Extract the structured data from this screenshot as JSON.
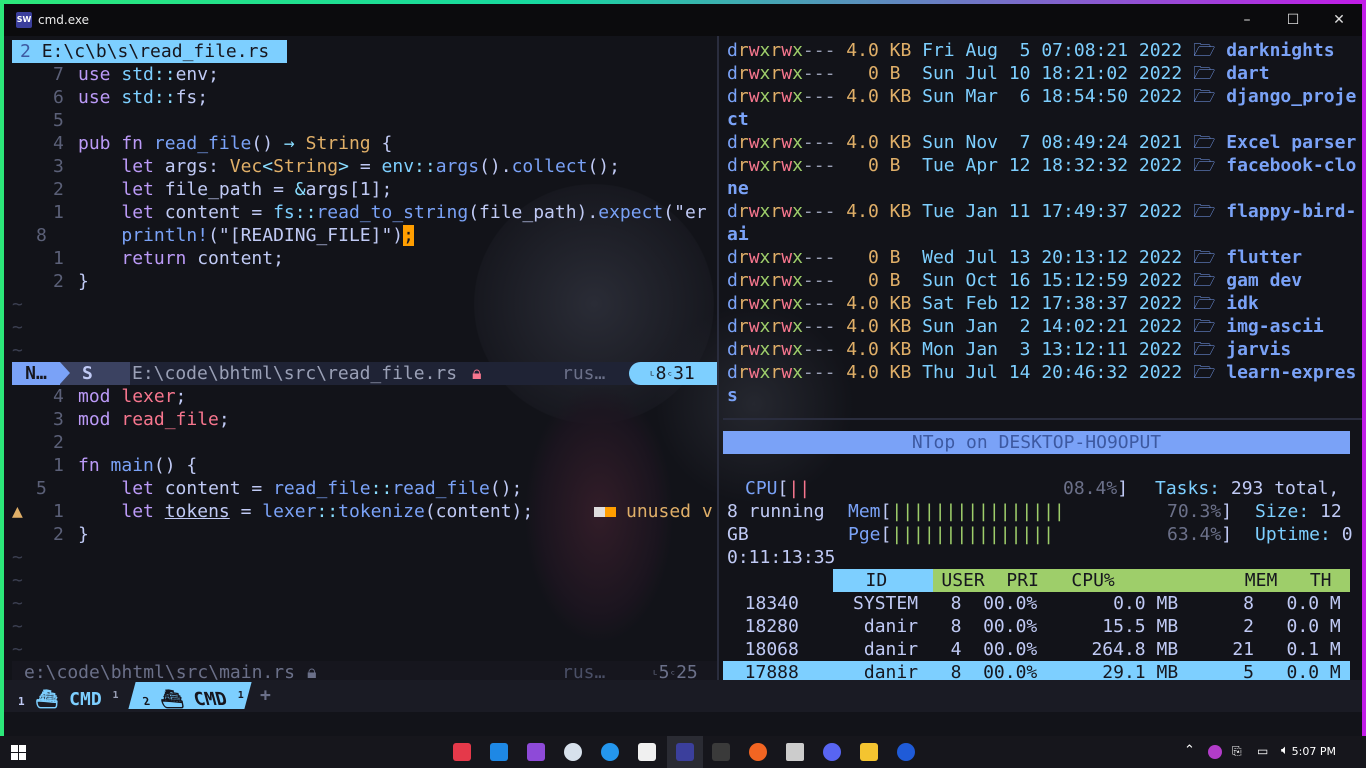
{
  "window": {
    "title": "cmd.exe",
    "icon": "SW",
    "minimize": "–",
    "maximize": "☐",
    "close": "✕"
  },
  "editor_top": {
    "tab": {
      "num": "2",
      "path": "E:\\c\\b\\s\\read_file.rs"
    },
    "lines": [
      {
        "n": "7",
        "parts": [
          [
            "kw",
            "use "
          ],
          [
            "ns",
            "std"
          ],
          [
            "op",
            "::"
          ],
          [
            "plain",
            "env;"
          ]
        ]
      },
      {
        "n": "6",
        "parts": [
          [
            "kw",
            "use "
          ],
          [
            "ns",
            "std"
          ],
          [
            "op",
            "::"
          ],
          [
            "plain",
            "fs;"
          ]
        ]
      },
      {
        "n": "5",
        "parts": []
      },
      {
        "n": "4",
        "parts": [
          [
            "kw",
            "pub fn "
          ],
          [
            "fn",
            "read_file"
          ],
          [
            "plain",
            "() "
          ],
          [
            "op",
            "→ "
          ],
          [
            "ty",
            "String"
          ],
          [
            "plain",
            " {"
          ]
        ]
      },
      {
        "n": "3",
        "parts": [
          [
            "plain",
            "    "
          ],
          [
            "kw",
            "let "
          ],
          [
            "plain",
            "args: "
          ],
          [
            "ty",
            "Vec"
          ],
          [
            "op",
            "<"
          ],
          [
            "ty",
            "String"
          ],
          [
            "op",
            "> "
          ],
          [
            "plain",
            "= "
          ],
          [
            "ns",
            "env"
          ],
          [
            "op",
            "::"
          ],
          [
            "fn",
            "args"
          ],
          [
            "plain",
            "()."
          ],
          [
            "fn",
            "collect"
          ],
          [
            "plain",
            "();"
          ]
        ]
      },
      {
        "n": "2",
        "parts": [
          [
            "plain",
            "    "
          ],
          [
            "kw",
            "let "
          ],
          [
            "plain",
            "file_path = "
          ],
          [
            "op",
            "&"
          ],
          [
            "plain",
            "args[1];"
          ]
        ]
      },
      {
        "n": "1",
        "parts": [
          [
            "plain",
            "    "
          ],
          [
            "kw",
            "let "
          ],
          [
            "plain",
            "content = "
          ],
          [
            "ns",
            "fs"
          ],
          [
            "op",
            "::"
          ],
          [
            "fn",
            "read_to_string"
          ],
          [
            "plain",
            "(file_path)."
          ],
          [
            "fn",
            "expect"
          ],
          [
            "plain",
            "(\"er"
          ]
        ]
      },
      {
        "n": "8",
        "parts": [
          [
            "plain",
            "    "
          ],
          [
            "fn",
            "println!"
          ],
          [
            "plain",
            "(\"[READING_FILE]\")"
          ]
        ],
        "cursor": ";"
      },
      {
        "n": "1",
        "parts": [
          [
            "plain",
            "    "
          ],
          [
            "kw",
            "return "
          ],
          [
            "plain",
            "content;"
          ]
        ]
      },
      {
        "n": "2",
        "parts": [
          [
            "plain",
            "}"
          ]
        ]
      }
    ],
    "status": {
      "mode": "N…",
      "sect": "S",
      "path": "E:\\code\\bhtml\\src\\read_file.rs",
      "lang": "rus…",
      "pos_l": "8",
      "pos_c": "31"
    }
  },
  "editor_bottom": {
    "lines": [
      {
        "n": "4",
        "parts": [
          [
            "kw",
            "mod "
          ],
          [
            "mod",
            "lexer"
          ],
          [
            "plain",
            ";"
          ]
        ]
      },
      {
        "n": "3",
        "parts": [
          [
            "kw",
            "mod "
          ],
          [
            "mod",
            "read_file"
          ],
          [
            "plain",
            ";"
          ]
        ]
      },
      {
        "n": "2",
        "parts": []
      },
      {
        "n": "1",
        "parts": [
          [
            "kw",
            "fn "
          ],
          [
            "fn",
            "main"
          ],
          [
            "plain",
            "() {"
          ]
        ]
      },
      {
        "n": "5",
        "parts": [
          [
            "plain",
            "    "
          ],
          [
            "kw",
            "let "
          ],
          [
            "plain",
            "content = "
          ],
          [
            "fn",
            "read_file"
          ],
          [
            "op",
            "::"
          ],
          [
            "fn",
            "read_file"
          ],
          [
            "plain",
            "();"
          ]
        ]
      },
      {
        "n": "1",
        "parts": [
          [
            "plain",
            "    "
          ],
          [
            "kw",
            "let "
          ],
          [
            "plain",
            "tokens = "
          ],
          [
            "fn",
            "lexer"
          ],
          [
            "op",
            "::"
          ],
          [
            "fn",
            "tokenize"
          ],
          [
            "plain",
            "(content);"
          ]
        ],
        "warn": "unused v"
      },
      {
        "n": "2",
        "parts": [
          [
            "plain",
            "}"
          ]
        ]
      }
    ],
    "status": {
      "path": "e:\\code\\bhtml\\src\\main.rs",
      "lang": "rus…",
      "pos_l": "5",
      "pos_c": "25"
    }
  },
  "listing": [
    {
      "perm": "drwxrwx---",
      "size": "4.0 KB",
      "date": "Fri Aug  5 07:08:21 2022",
      "name": "darknights"
    },
    {
      "perm": "drwxrwx---",
      "size": "  0 B ",
      "date": "Sun Jul 10 18:21:02 2022",
      "name": "dart"
    },
    {
      "perm": "drwxrwx---",
      "size": "4.0 KB",
      "date": "Sun Mar  6 18:54:50 2022",
      "name": "django_proje",
      "wrap": "ct"
    },
    {
      "perm": "drwxrwx---",
      "size": "4.0 KB",
      "date": "Sun Nov  7 08:49:24 2021",
      "name": "Excel parser"
    },
    {
      "perm": "drwxrwx---",
      "size": "  0 B ",
      "date": "Tue Apr 12 18:32:32 2022",
      "name": "facebook-clo",
      "wrap": "ne"
    },
    {
      "perm": "drwxrwx---",
      "size": "4.0 KB",
      "date": "Tue Jan 11 17:49:37 2022",
      "name": "flappy-bird-",
      "wrap": "ai"
    },
    {
      "perm": "drwxrwx---",
      "size": "  0 B ",
      "date": "Wed Jul 13 20:13:12 2022",
      "name": "flutter"
    },
    {
      "perm": "drwxrwx---",
      "size": "  0 B ",
      "date": "Sun Oct 16 15:12:59 2022",
      "name": "gam dev"
    },
    {
      "perm": "drwxrwx---",
      "size": "4.0 KB",
      "date": "Sat Feb 12 17:38:37 2022",
      "name": "idk"
    },
    {
      "perm": "drwxrwx---",
      "size": "4.0 KB",
      "date": "Sun Jan  2 14:02:21 2022",
      "name": "img-ascii"
    },
    {
      "perm": "drwxrwx---",
      "size": "4.0 KB",
      "date": "Mon Jan  3 13:12:11 2022",
      "name": "jarvis"
    },
    {
      "perm": "drwxrwx---",
      "size": "4.0 KB",
      "date": "Thu Jul 14 20:46:32 2022",
      "name": "learn-expres",
      "wrap": "s"
    }
  ],
  "ntop": {
    "header": "NTop on DESKTOP-HO9OPUT",
    "cpu_label": "CPU",
    "cpu_bar": "||",
    "cpu_pct": "08.4%",
    "cpu_value": 0.084,
    "tasks_label": "Tasks:",
    "tasks_value": "293 total,",
    "running": "8 running",
    "mem_label": "Mem",
    "mem_bar": "||||||||||||||||",
    "mem_pct": "70.3%",
    "mem_value": 0.703,
    "size_label": "Size:",
    "size_value": "12",
    "gb": "GB",
    "pge_label": "Pge",
    "pge_bar": "|||||||||||||||",
    "pge_pct": "63.4%",
    "pge_value": 0.634,
    "uptime_label": "Uptime:",
    "uptime_value": "0",
    "uptime_rest": "0:11:13:35",
    "columns": "   ID     USER  PRI   CPU%            MEM   TH",
    "rows": [
      "  18340     SYSTEM   8  00.0%       0.0 MB      8   0.0 M",
      "  18280      danir   8  00.0%      15.5 MB      2   0.0 M",
      "  18068      danir   4  00.0%     264.8 MB     21   0.1 M",
      "  17888      danir   8  00.0%      29.1 MB      5   0.0 M"
    ],
    "selected_row": 3
  },
  "tabs": [
    {
      "index": "1",
      "label": "CMD",
      "count": "1"
    },
    {
      "index": "2",
      "label": "CMD",
      "count": "1"
    }
  ],
  "new_tab": "+",
  "taskbar": {
    "clock": "5:07 PM"
  }
}
